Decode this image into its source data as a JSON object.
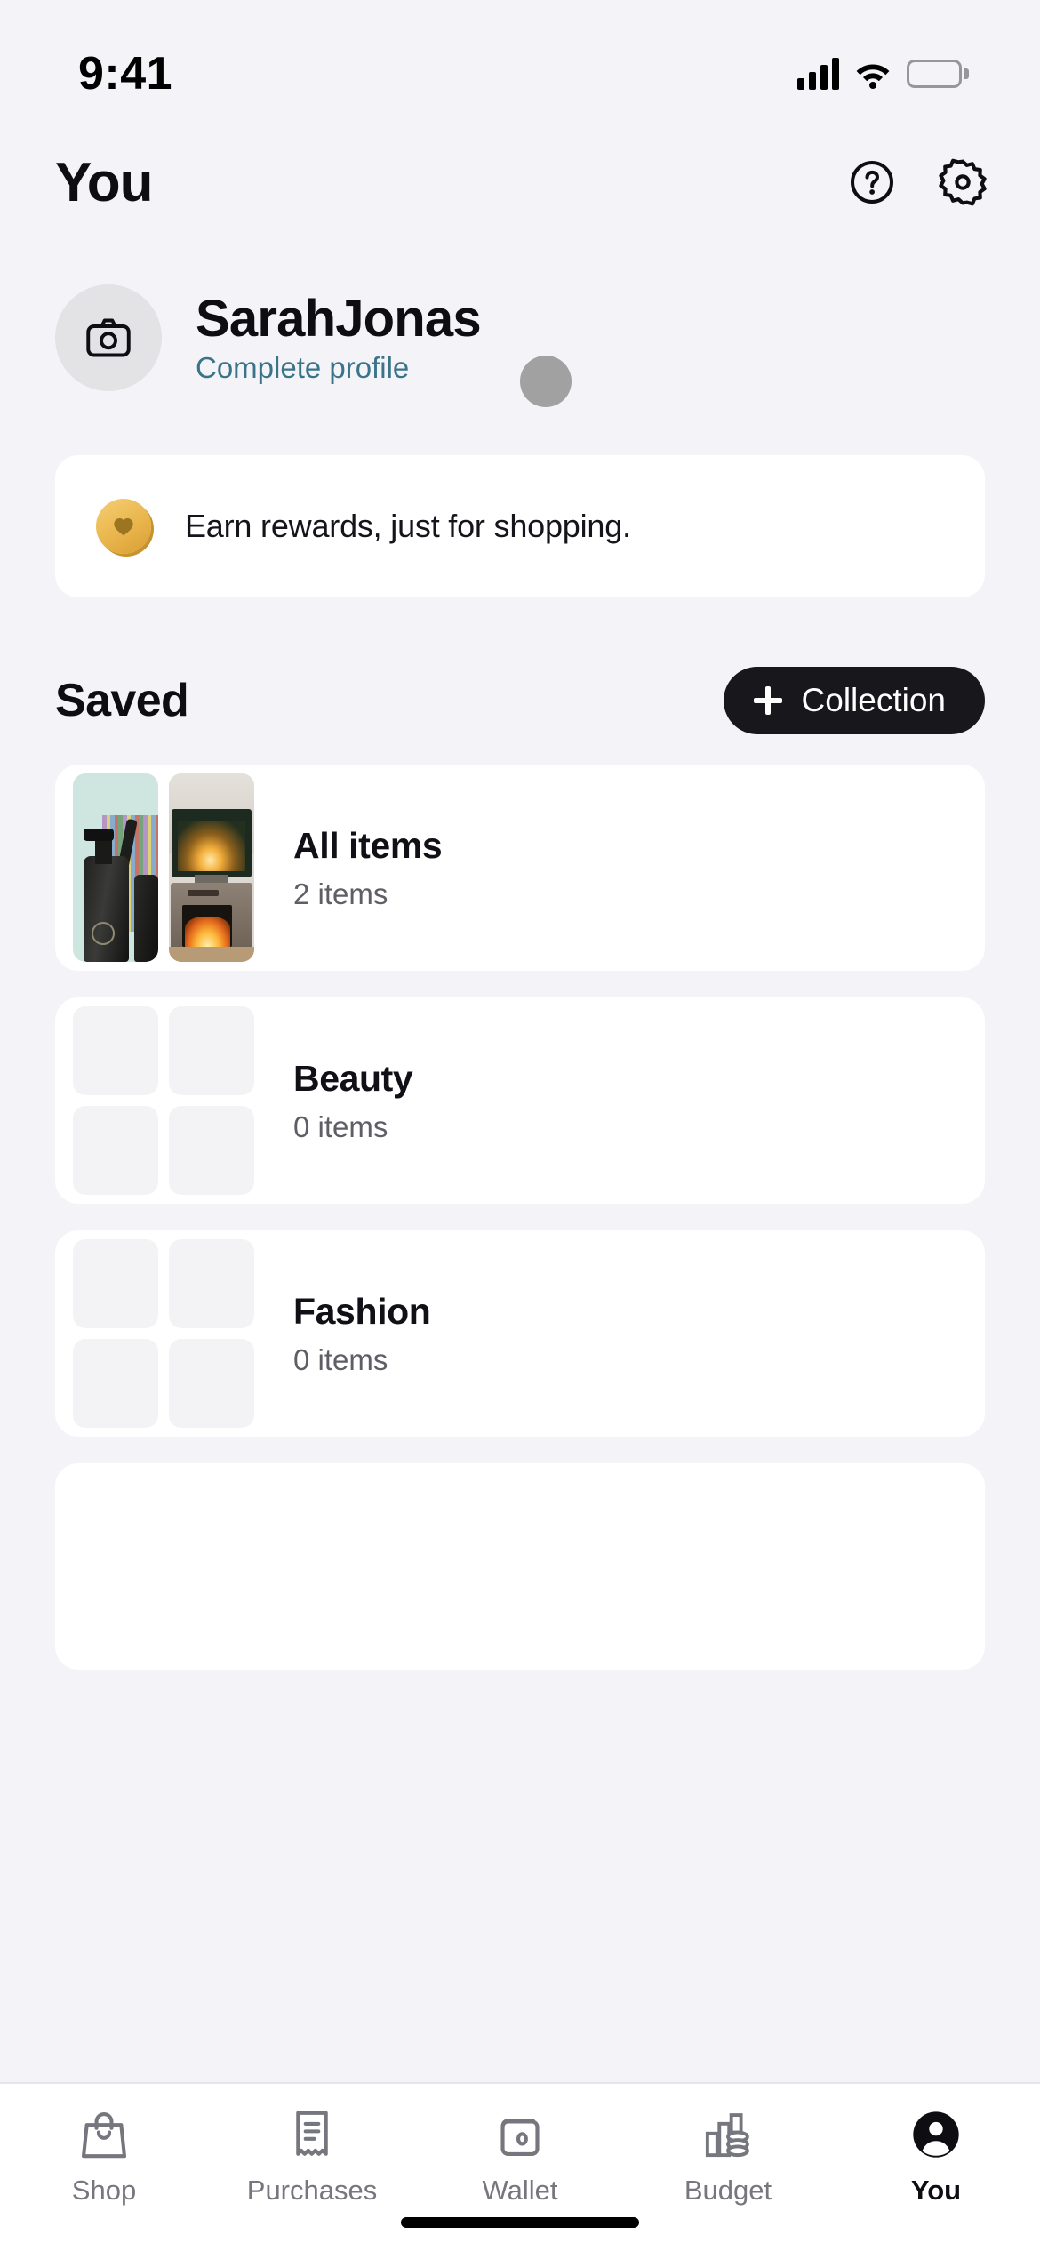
{
  "status_bar": {
    "time": "9:41",
    "signal_icon": "cellular-signal-icon",
    "wifi_icon": "wifi-icon",
    "battery_icon": "battery-icon"
  },
  "header": {
    "title": "You",
    "help_icon": "help-circle-icon",
    "settings_icon": "gear-icon"
  },
  "profile": {
    "avatar_icon": "camera-icon",
    "name": "SarahJonas",
    "link_label": "Complete profile",
    "link_color": "#3a7489"
  },
  "rewards_banner": {
    "icon": "gold-coin-heart-icon",
    "text": "Earn rewards, just for shopping."
  },
  "saved": {
    "title": "Saved",
    "add_button_label": "Collection",
    "add_button_icon": "plus-icon",
    "add_button_color": "#17171c",
    "collections": [
      {
        "name": "All items",
        "count": "2 items",
        "thumbnails": [
          "black-pump-bottle-thumbnail",
          "fireplace-tv-console-thumbnail"
        ],
        "has_images": true
      },
      {
        "name": "Beauty",
        "count": "0 items",
        "thumbnails": [],
        "has_images": false
      },
      {
        "name": "Fashion",
        "count": "0 items",
        "thumbnails": [],
        "has_images": false
      }
    ]
  },
  "tab_bar": {
    "items": [
      {
        "label": "Shop",
        "icon": "shopping-bag-icon",
        "active": false
      },
      {
        "label": "Purchases",
        "icon": "receipt-icon",
        "active": false
      },
      {
        "label": "Wallet",
        "icon": "wallet-icon",
        "active": false
      },
      {
        "label": "Budget",
        "icon": "budget-chart-coins-icon",
        "active": false
      },
      {
        "label": "You",
        "icon": "person-filled-icon",
        "active": true
      }
    ]
  }
}
